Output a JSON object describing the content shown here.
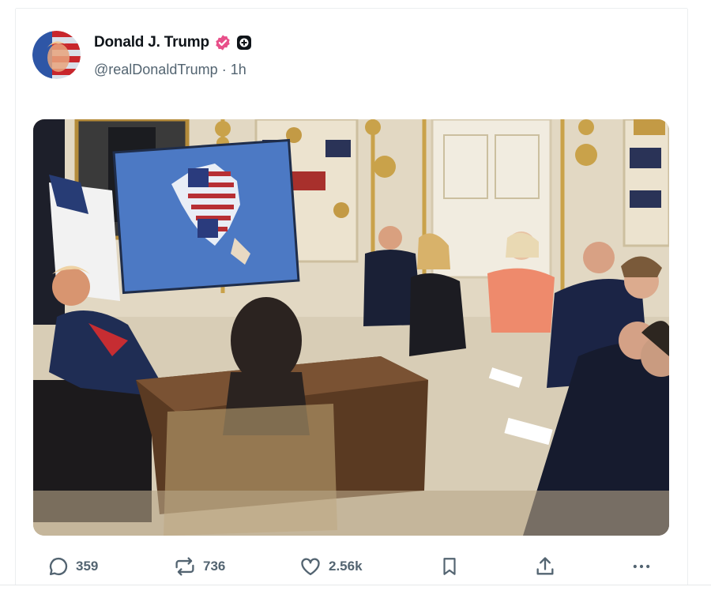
{
  "post": {
    "author": {
      "display_name": "Donald J. Trump",
      "handle": "@realDonaldTrump",
      "time_sep": "·",
      "time": "1h",
      "verified_icon": "verified-badge-icon",
      "plus_icon": "plus-badge-icon"
    },
    "media": {
      "type": "photo",
      "map_icon": "north-america-flag-map"
    },
    "actions": {
      "reply_count": "359",
      "repost_count": "736",
      "like_count": "2.56k"
    }
  },
  "colors": {
    "text_primary": "#0f1419",
    "text_secondary": "#536471",
    "verified_pink": "#e8508a",
    "divider": "#eceef0"
  }
}
